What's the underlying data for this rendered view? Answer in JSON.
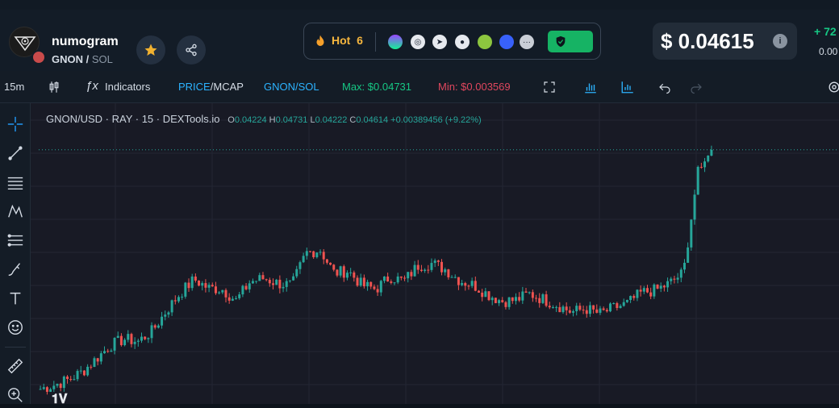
{
  "token": {
    "name": "numogram",
    "base": "GNON",
    "quote": "SOL"
  },
  "hot": {
    "label": "Hot",
    "rank": "6"
  },
  "socials": [
    "solana-icon",
    "globe-icon",
    "telegram-icon",
    "reddit-icon",
    "coingecko-icon",
    "coinmarketcap-icon",
    "more-icon"
  ],
  "price": {
    "value": "$ 0.04615",
    "change": "+ 72",
    "change2": "0.00"
  },
  "toolbar": {
    "interval": "15m",
    "indicators": "Indicators",
    "price_label": "PRICE",
    "mcap_label": "MCAP",
    "pair_label": "GNON/SOL",
    "max": "Max: $0.04731",
    "min": "Min: $0.003569"
  },
  "legend": {
    "title": "GNON/USD · RAY · 15 · DEXTools.io",
    "o_label": "O",
    "o": "0.04224",
    "h_label": "H",
    "h": "0.04731",
    "l_label": "L",
    "l": "0.04222",
    "c_label": "C",
    "c": "0.04614",
    "change": "+0.00389456 (+9.22%)"
  },
  "colors": {
    "up": "#26a69a",
    "down": "#ef5350",
    "accent": "#2196f3",
    "max": "#16c784",
    "min": "#e0475e"
  },
  "chart_data": {
    "type": "candlestick",
    "series": [
      {
        "values": [
          0.0045,
          0.0052,
          0.0061,
          0.0075,
          0.0098,
          0.0121,
          0.0132,
          0.0128,
          0.0146,
          0.0181,
          0.0212,
          0.0236,
          0.0221,
          0.0219,
          0.0199,
          0.0232,
          0.0238,
          0.0229,
          0.0226,
          0.0282,
          0.0288,
          0.0247,
          0.0251,
          0.0226,
          0.0219,
          0.0241,
          0.0233,
          0.026,
          0.0264,
          0.0253,
          0.0234,
          0.0226,
          0.021,
          0.0198,
          0.02,
          0.0211,
          0.0201,
          0.0191,
          0.0179,
          0.0185,
          0.0176,
          0.0186,
          0.0194,
          0.0213,
          0.0217,
          0.0229,
          0.0248,
          0.042,
          0.0462
        ]
      }
    ]
  }
}
